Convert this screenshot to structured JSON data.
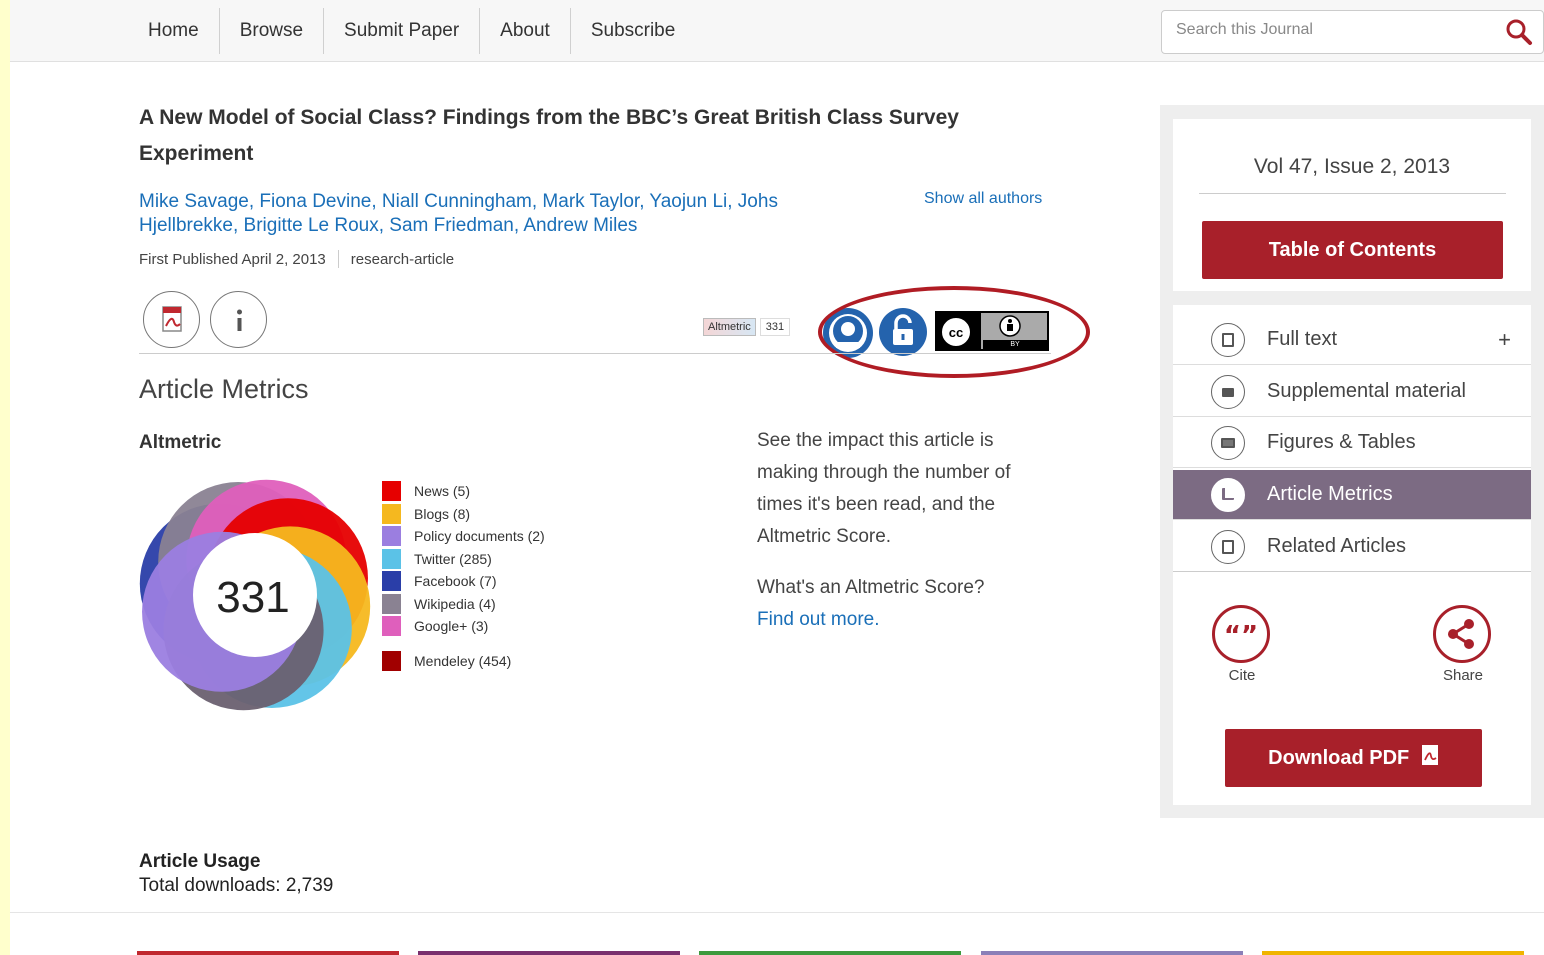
{
  "nav": {
    "items": [
      "Home",
      "Browse",
      "Submit Paper",
      "About",
      "Subscribe"
    ]
  },
  "search": {
    "placeholder": "Search this Journal"
  },
  "article": {
    "title": "A New Model of Social Class? Findings from the BBC’s Great British Class Survey Experiment",
    "authors": "Mike Savage, Fiona Devine, Niall Cunningham, Mark Taylor, Yaojun Li, Johs Hjellbrekke, Brigitte Le Roux, Sam Friedman, Andrew Miles",
    "show_all_authors": "Show all authors",
    "first_published": "First Published April 2, 2013",
    "article_type": "research-article"
  },
  "badges": {
    "altmetric_label": "Altmetric",
    "altmetric_score": "331",
    "cc_label": "BY"
  },
  "metrics": {
    "heading": "Article Metrics",
    "altmetric_heading": "Altmetric",
    "score": "331",
    "legend": [
      {
        "label": "News (5)",
        "color": "#e60000"
      },
      {
        "label": "Blogs (8)",
        "color": "#f5b81f"
      },
      {
        "label": "Policy documents (2)",
        "color": "#9b7ee0"
      },
      {
        "label": "Twitter (285)",
        "color": "#5bc2e7"
      },
      {
        "label": "Facebook (7)",
        "color": "#2a3ea8"
      },
      {
        "label": "Wikipedia (4)",
        "color": "#8a8292"
      },
      {
        "label": "Google+ (3)",
        "color": "#df5fbc"
      },
      {
        "label": "Mendeley (454)",
        "color": "#a10000"
      }
    ],
    "impact_text": "See the impact this article is making through the number of times it's been read, and the Altmetric Score.",
    "whats_score": "What's an Altmetric Score?",
    "find_out": "Find out more."
  },
  "usage": {
    "heading": "Article Usage",
    "total": "Total downloads: 2,739"
  },
  "sidebar": {
    "volume": "Vol 47, Issue 2, 2013",
    "toc": "Table of Contents",
    "items": [
      "Full text",
      "Supplemental material",
      "Figures & Tables",
      "Article Metrics",
      "Related Articles"
    ],
    "plus": "+",
    "cite": "Cite",
    "share": "Share",
    "download_pdf": "Download PDF"
  },
  "colors": {
    "brand": "#a8202a",
    "active": "#7c6b83",
    "link": "#1a6fb8"
  }
}
